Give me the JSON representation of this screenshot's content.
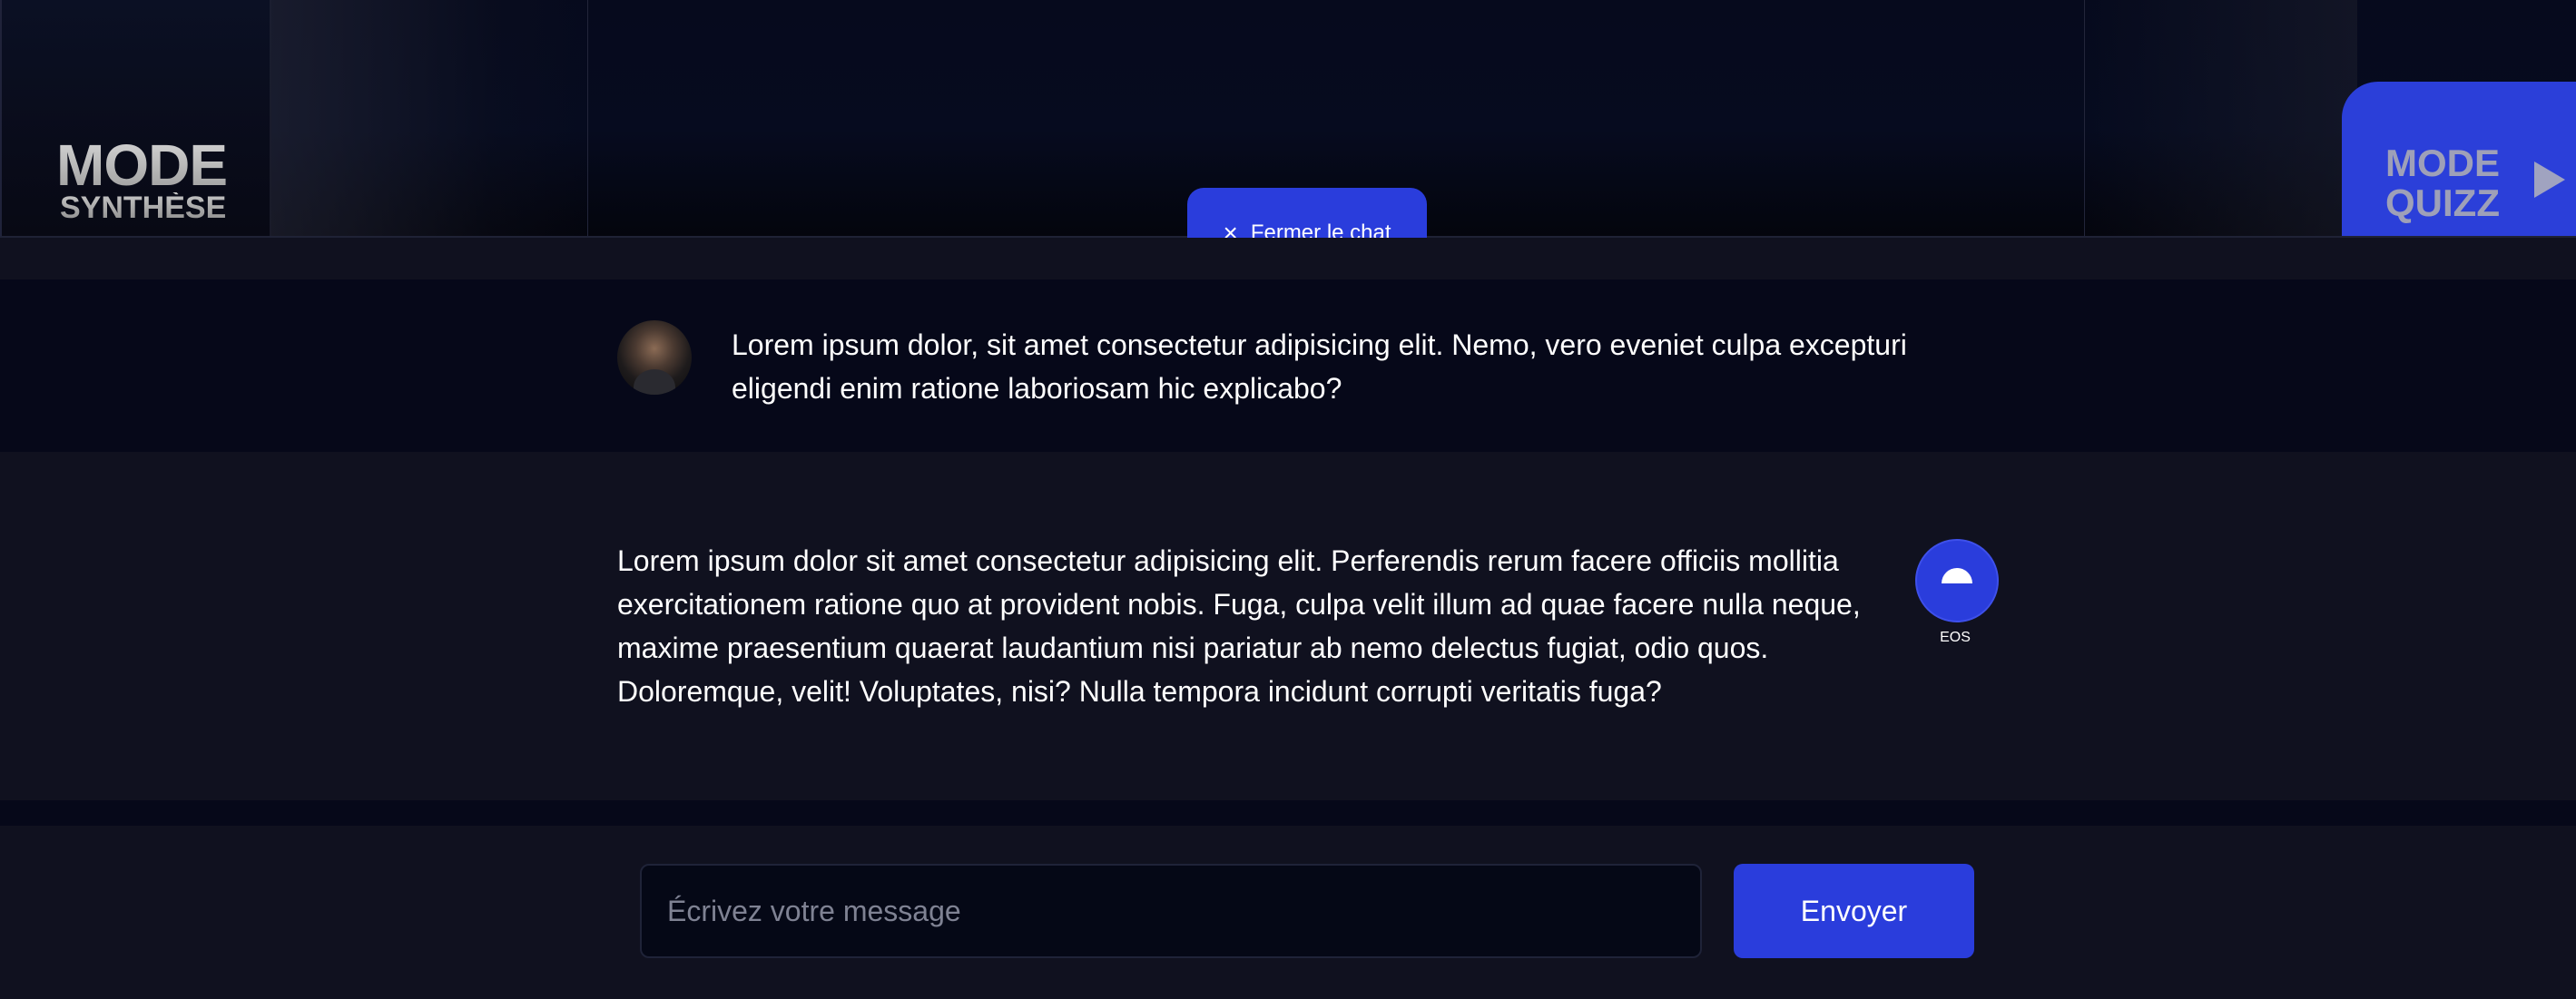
{
  "header": {
    "mode_synthese": {
      "title": "MODE",
      "subtitle": "SYNTHÈSE"
    },
    "mode_quizz": {
      "line1": "MODE",
      "line2": "QUIZZ",
      "icon": "play-icon"
    },
    "close_chat": {
      "label": "Fermer le chat",
      "icon": "close-icon"
    }
  },
  "chat": {
    "messages": [
      {
        "role": "user",
        "avatar": "user-avatar",
        "text": "Lorem ipsum dolor, sit amet consectetur adipisicing elit. Nemo, vero eveniet culpa excepturi eligendi enim ratione laboriosam hic explicabo?"
      },
      {
        "role": "assistant",
        "badge_label": "EOS",
        "text": "Lorem ipsum dolor sit amet consectetur adipisicing elit. Perferendis rerum facere officiis mollitia exercitationem ratione quo at provident nobis. Fuga, culpa velit illum ad quae facere nulla neque, maxime praesentium quaerat laudantium nisi pariatur ab nemo delectus fugiat, odio quos. Doloremque, velit! Voluptates, nisi? Nulla tempora incidunt corrupti veritatis fuga?"
      }
    ]
  },
  "composer": {
    "placeholder": "Écrivez votre message",
    "value": "",
    "send_label": "Envoyer"
  },
  "colors": {
    "accent": "#2a3ddc",
    "background": "#10111f",
    "user_row": "#060819"
  }
}
